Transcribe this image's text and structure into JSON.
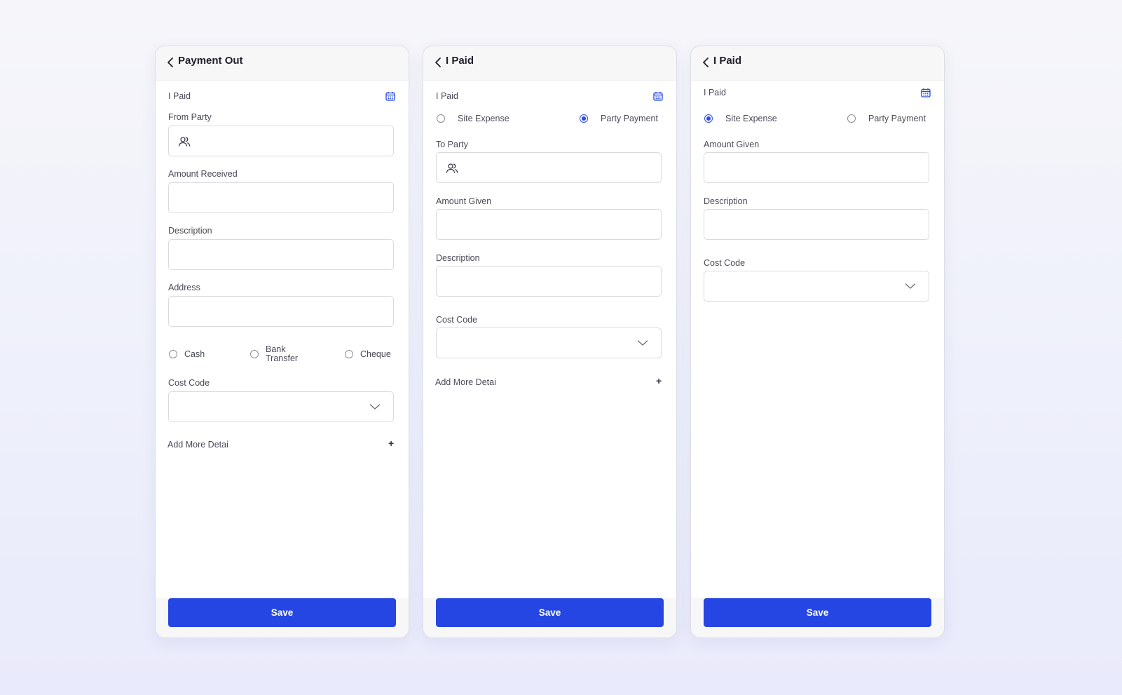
{
  "colors": {
    "accent": "#2546e2",
    "background": "#f0f1fb",
    "card": "#ffffff",
    "border": "#d9dae2"
  },
  "screens": [
    {
      "title": "Payment Out",
      "section_label": "I Paid",
      "from_party_label": "From Party",
      "amount_label": "Amount Received",
      "description_label": "Description",
      "address_label": "Address",
      "payment_modes": [
        "Cash",
        "Bank Transfer",
        "Cheque"
      ],
      "payment_mode_bank_line1": "Bank",
      "payment_mode_bank_line2": "Transfer",
      "cost_code_label": "Cost Code",
      "add_more_label": "Add More Detai",
      "add_more_icon": "+",
      "save_label": "Save"
    },
    {
      "title": "I Paid",
      "section_label": "I Paid",
      "radio_options": [
        "Site Expense",
        "Party Payment"
      ],
      "selected_option": "Party Payment",
      "to_party_label": "To Party",
      "amount_label": "Amount Given",
      "description_label": "Description",
      "cost_code_label": "Cost Code",
      "add_more_label": "Add More Detai",
      "add_more_icon": "+",
      "save_label": "Save"
    },
    {
      "title": "I Paid",
      "section_label": "I Paid",
      "radio_options": [
        "Site Expense",
        "Party Payment"
      ],
      "selected_option": "Site Expense",
      "amount_label": "Amount Given",
      "description_label": "Description",
      "cost_code_label": "Cost Code",
      "save_label": "Save"
    }
  ],
  "icons": [
    "back-arrow-icon",
    "calendar-icon",
    "users-icon",
    "chevron-down-icon"
  ]
}
